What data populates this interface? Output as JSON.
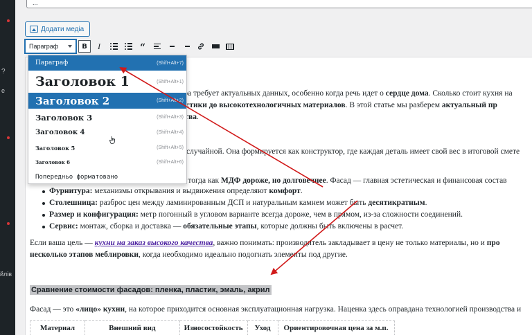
{
  "sidebar": {
    "fragments": [
      "е",
      "йлів"
    ]
  },
  "editor": {
    "title_value": "...",
    "add_media_label": "Додати медіа",
    "format_select": {
      "value": "Параграф"
    },
    "toolbar_icons": [
      "bold-icon",
      "italic-icon",
      "bulleted-list-icon",
      "numbered-list-icon",
      "blockquote-icon",
      "align-left-icon",
      "align-center-icon",
      "align-right-icon",
      "link-icon",
      "read-more-icon",
      "toolbar-toggle-icon"
    ]
  },
  "dropdown": {
    "items": [
      {
        "label": "Параграф",
        "shortcut": "(Shift+Alt+7)"
      },
      {
        "label": "Заголовок 1",
        "shortcut": "(Shift+Alt+1)"
      },
      {
        "label": "Заголовок 2",
        "shortcut": "(Shift+Alt+2)"
      },
      {
        "label": "Заголовок 3",
        "shortcut": "(Shift+Alt+3)"
      },
      {
        "label": "Заголовок 4",
        "shortcut": "(Shift+Alt+4)"
      },
      {
        "label": "Заголовок 5",
        "shortcut": "(Shift+Alt+5)"
      },
      {
        "label": "Заголовок 6",
        "shortcut": "(Shift+Alt+6)"
      },
      {
        "label": "Попередньо форматовано",
        "shortcut": ""
      }
    ]
  },
  "content": {
    "p1": {
      "a": "ьера требует актуальных данных, особенно когда речь идет о ",
      "b": "сердце дома",
      "c": ". Сколько стоит кухня на"
    },
    "p2": {
      "a": "тистики до высокотехнологичных материалов",
      "b": ". В этой статье мы разберем ",
      "c": "актуальный пр"
    },
    "p3": {
      "a": "ества",
      "b": "."
    },
    "p4": "ет случайной. Она формируется как конструктор, где каждая деталь имеет свой вес в итоговой смете",
    "p5": {
      "a": "за, тогда как ",
      "b": "МДФ дороже, но долговечнее",
      "c": ". Фасад — главная эстетическая и финансовая состав"
    },
    "bullets": [
      {
        "term": "Фурнитура:",
        "text": " механизмы открывания и выдвижения определяют ",
        "em": "комфорт",
        "end": "."
      },
      {
        "term": "Столешница:",
        "text": " разброс цен между ламинированным ДСП и натуральным камнем может быть ",
        "em": "десятикратным",
        "end": "."
      },
      {
        "term": "Размер и конфигурация:",
        "text": " метр погонный в угловом варианте всегда дороже, чем в прямом, из-за сложности соединений.",
        "em": "",
        "end": ""
      },
      {
        "term": "Сервис:",
        "text": " монтаж, сборка и доставка — ",
        "em": "обязательные этапы",
        "end": ", которые должны быть включены в расчет."
      }
    ],
    "p6": {
      "a": "Если ваша цель — ",
      "link": "кухни на заказ высокого качества",
      "b": ", важно понимать: производитель закладывает в цену не только материалы, но и ",
      "c": "про"
    },
    "p7": {
      "a": "несколько этапов меблировки",
      "b": ", когда необходимо идеально подогнать элементы под другие."
    },
    "h2": "Сравнение стоимости фасадов: пленка, пластик, эмаль, акрил",
    "p8": {
      "a": "Фасад — это ",
      "b": "«лицо» кухни",
      "c": ", на которое приходится основная эксплуатационная нагрузка. Наценка здесь оправдана технологией производства и"
    },
    "table_headers": [
      "Материал",
      "Внешний вид",
      "Износостойкость",
      "Уход",
      "Ориентировочная цена за м.п."
    ]
  },
  "colors": {
    "accent": "#2271b1",
    "arrow": "#d11a1a",
    "sidebar": "#1d2327"
  }
}
